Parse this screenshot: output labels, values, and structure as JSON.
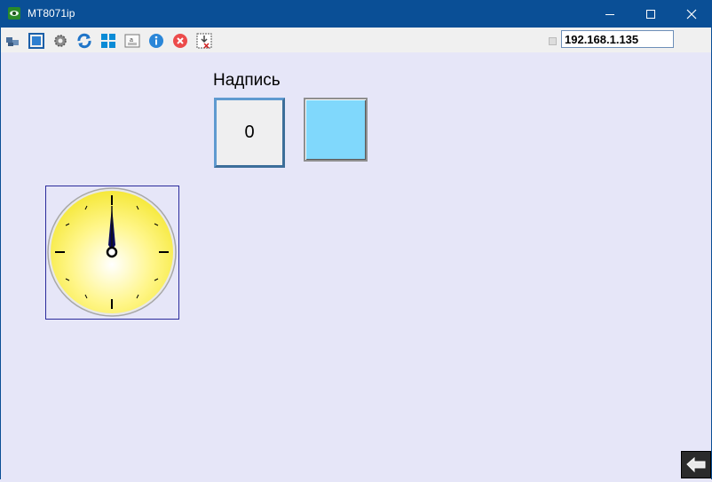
{
  "window": {
    "title": "MT8071ip",
    "minimize_icon": "minimize-icon",
    "maximize_icon": "maximize-icon",
    "close_icon": "close-icon"
  },
  "toolbar": {
    "icons": [
      "network-icon",
      "fullscreen-icon",
      "settings-gear-icon",
      "refresh-icon",
      "windows-icon",
      "disk-icon",
      "info-icon",
      "stop-icon",
      "export-icon"
    ],
    "ip_address": "192.168.1.135"
  },
  "screen": {
    "label_text": "Надпись",
    "numeric_value": "0",
    "lamp_color": "#80d8fc",
    "clock_face_color": "#fff27a",
    "clock_hand": "12"
  },
  "footer": {
    "back_icon": "back-arrow-icon"
  },
  "colors": {
    "titlebar": "#0a4f96",
    "screen_background": "#e6e6f8"
  }
}
